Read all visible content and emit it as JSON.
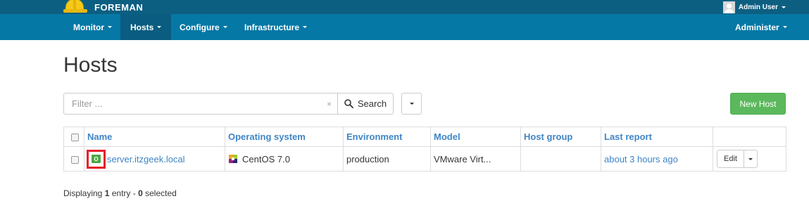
{
  "brand": {
    "name": "FOREMAN"
  },
  "user_menu": {
    "label": "Admin User"
  },
  "nav": {
    "items": [
      {
        "label": "Monitor"
      },
      {
        "label": "Hosts"
      },
      {
        "label": "Configure"
      },
      {
        "label": "Infrastructure"
      }
    ],
    "administer": "Administer"
  },
  "page": {
    "title": "Hosts"
  },
  "search": {
    "placeholder": "Filter ...",
    "clear_glyph": "×",
    "button_label": "Search"
  },
  "new_host_label": "New Host",
  "table": {
    "columns": [
      "Name",
      "Operating system",
      "Environment",
      "Model",
      "Host group",
      "Last report"
    ],
    "rows": [
      {
        "status": "O",
        "name": "server.itzgeek.local",
        "os": "CentOS 7.0",
        "environment": "production",
        "model": "VMware Virt...",
        "host_group": "",
        "last_report": "about 3 hours ago",
        "action": "Edit"
      }
    ]
  },
  "footer": {
    "prefix": "Displaying ",
    "count": "1",
    "middle": " entry - ",
    "selected": "0",
    "suffix": " selected"
  },
  "colors": {
    "topbar": "#0d5f82",
    "navbar": "#0678a5",
    "nav_active": "#0a5c80",
    "link": "#3f85c6",
    "success": "#5cb85c",
    "highlight": "#e61e27"
  }
}
